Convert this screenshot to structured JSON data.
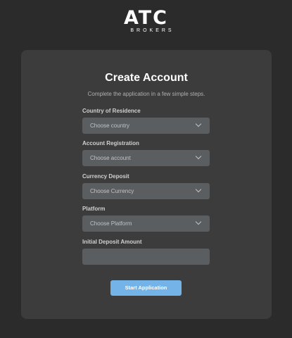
{
  "logo": {
    "main": "ATC",
    "sub": "BROKERS"
  },
  "form": {
    "title": "Create Account",
    "subtitle": "Complete the application in a few simple steps.",
    "fields": [
      {
        "label": "Country of Residence",
        "placeholder": "Choose country",
        "type": "select"
      },
      {
        "label": "Account Registration",
        "placeholder": "Choose account",
        "type": "select"
      },
      {
        "label": "Currency Deposit",
        "placeholder": "Choose Currency",
        "type": "select"
      },
      {
        "label": "Platform",
        "placeholder": "Choose Platform",
        "type": "select"
      },
      {
        "label": "Initial Deposit Amount",
        "placeholder": "",
        "type": "text"
      }
    ],
    "submit_label": "Start Application"
  },
  "colors": {
    "background": "#2b2b2b",
    "card": "#3c3c3c",
    "field": "#5a5e61",
    "accent": "#74b3e8"
  }
}
